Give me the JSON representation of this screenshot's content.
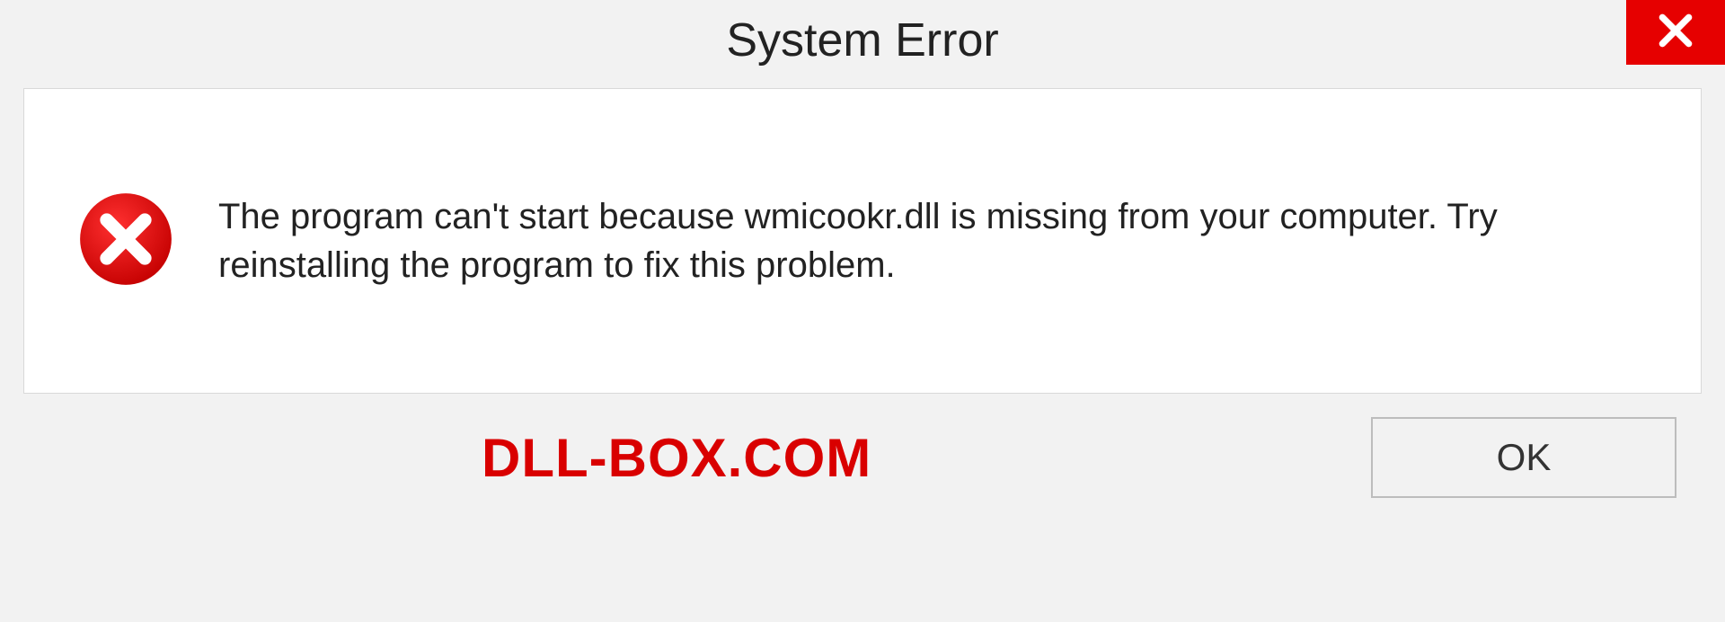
{
  "dialog": {
    "title": "System Error",
    "message": "The program can't start because wmicookr.dll is missing from your computer. Try reinstalling the program to fix this problem.",
    "ok_label": "OK"
  },
  "watermark": "DLL-BOX.COM",
  "colors": {
    "accent_red": "#e60000",
    "watermark_red": "#d90000"
  }
}
